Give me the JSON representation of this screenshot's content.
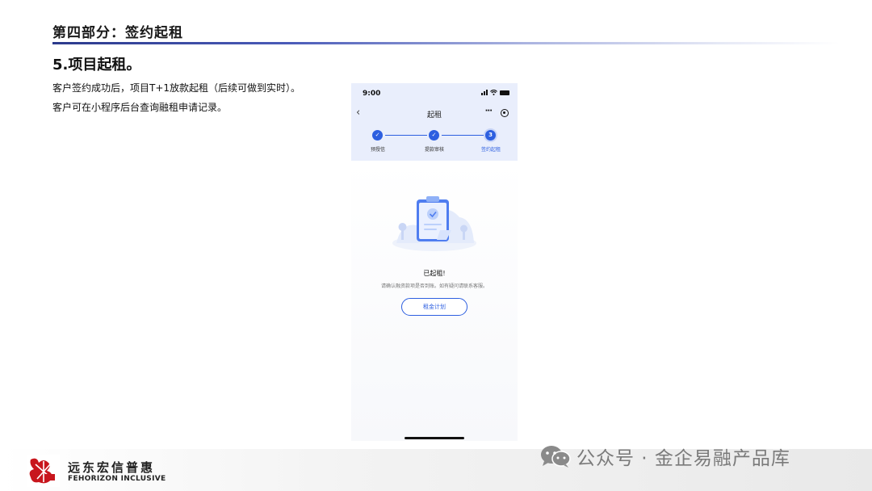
{
  "slide": {
    "section_title": "第四部分：签约起租",
    "subheading": "5.项目起租。",
    "body_lines": [
      "客户签约成功后，项目T+1放款起租（后续可做到实时）。",
      "客户可在小程序后台查询融租申请记录。"
    ]
  },
  "phone": {
    "time": "9:00",
    "nav_title": "起租",
    "more_icon": "···",
    "back_icon": "‹",
    "steps": [
      {
        "mark": "✓",
        "label": "预授信"
      },
      {
        "mark": "✓",
        "label": "提款审核"
      },
      {
        "mark": "3",
        "label": "签约起租"
      }
    ],
    "result_title": "已起租!",
    "result_desc": "请确认融资款项是否到账。如有疑问请联系客服。",
    "plan_button": "租金计划",
    "accent_color": "#2d5fe0"
  },
  "footer": {
    "company_cn": "远东宏信普惠",
    "company_en": "FEHORIZON INCLUSIVE",
    "logo_text": "远东宏信 普惠",
    "watermark": "公众号 · 金企易融产品库"
  }
}
